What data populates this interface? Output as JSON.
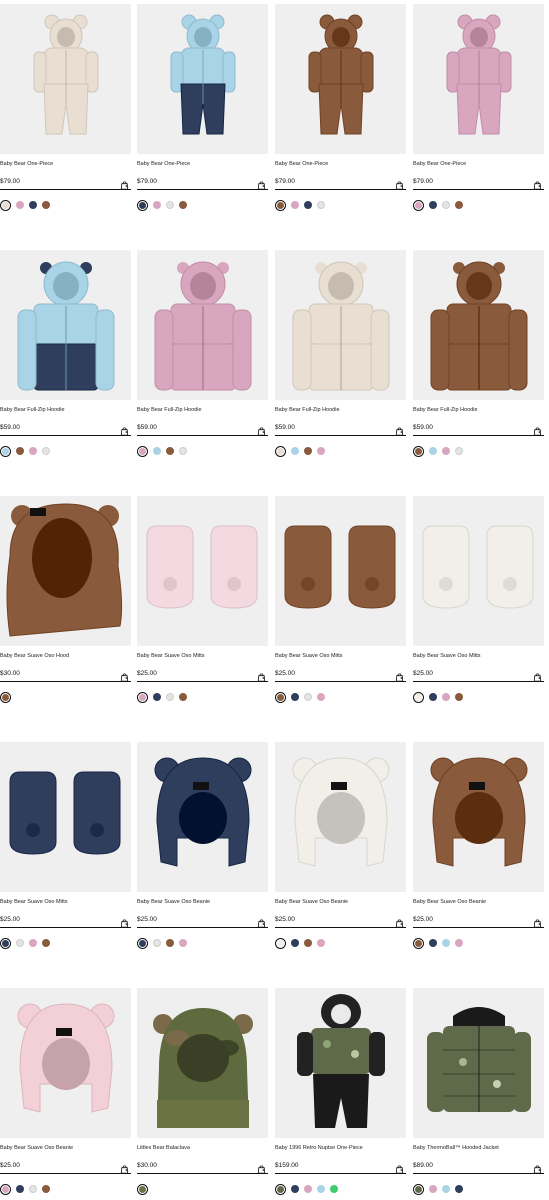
{
  "colors": {
    "cream": "#e8dfd2",
    "pink": "#d9a6bf",
    "navy": "#2e3e5c",
    "brown": "#8a5a3c",
    "lightblue": "#a9d3e6",
    "lightgray": "#e4e4e4",
    "offwhite": "#f2eee8",
    "olive": "#6b7345",
    "green": "#3fcf6f",
    "camo": "#5f6a4a"
  },
  "products": [
    {
      "name": "Baby Bear One-Piece",
      "price": "$79.00",
      "image": "bear-one-piece-cream",
      "swatches": [
        "cream",
        "pink",
        "navy",
        "brown"
      ],
      "selected": 0
    },
    {
      "name": "Baby Bear One-Piece",
      "price": "$79.00",
      "image": "bear-one-piece-blue",
      "swatches": [
        "navy",
        "pink",
        "lightgray",
        "brown"
      ],
      "selected": 0
    },
    {
      "name": "Baby Bear One-Piece",
      "price": "$79.00",
      "image": "bear-one-piece-brown",
      "swatches": [
        "brown",
        "pink",
        "navy",
        "lightgray"
      ],
      "selected": 0
    },
    {
      "name": "Baby Bear One-Piece",
      "price": "$79.00",
      "image": "bear-one-piece-pink",
      "swatches": [
        "pink",
        "navy",
        "lightgray",
        "brown"
      ],
      "selected": 0
    },
    {
      "name": "Baby Bear Full-Zip Hoodie",
      "price": "$59.00",
      "image": "hoodie-blue",
      "swatches": [
        "lightblue",
        "brown",
        "pink",
        "lightgray"
      ],
      "selected": 0
    },
    {
      "name": "Baby Bear Full-Zip Hoodie",
      "price": "$59.00",
      "image": "hoodie-pink",
      "swatches": [
        "pink",
        "lightblue",
        "brown",
        "lightgray"
      ],
      "selected": 0
    },
    {
      "name": "Baby Bear Full-Zip Hoodie",
      "price": "$59.00",
      "image": "hoodie-cream",
      "swatches": [
        "cream",
        "lightblue",
        "brown",
        "pink"
      ],
      "selected": 0
    },
    {
      "name": "Baby Bear Full-Zip Hoodie",
      "price": "$59.00",
      "image": "hoodie-brown",
      "swatches": [
        "brown",
        "lightblue",
        "pink",
        "lightgray"
      ],
      "selected": 0
    },
    {
      "name": "Baby Bear Suave Oso Hood",
      "price": "$30.00",
      "image": "hood-brown",
      "swatches": [
        "brown"
      ],
      "selected": 0
    },
    {
      "name": "Baby Bear Suave Oso Mitts",
      "price": "$25.00",
      "image": "mitts-pink",
      "swatches": [
        "pink",
        "navy",
        "lightgray",
        "brown"
      ],
      "selected": 0
    },
    {
      "name": "Baby Bear Suave Oso Mitts",
      "price": "$25.00",
      "image": "mitts-brown",
      "swatches": [
        "brown",
        "navy",
        "lightgray",
        "pink"
      ],
      "selected": 0
    },
    {
      "name": "Baby Bear Suave Oso Mitts",
      "price": "$25.00",
      "image": "mitts-white",
      "swatches": [
        "offwhite",
        "navy",
        "pink",
        "brown"
      ],
      "selected": 0
    },
    {
      "name": "Baby Bear Suave Oso Mitts",
      "price": "$25.00",
      "image": "mitts-navy",
      "swatches": [
        "navy",
        "lightgray",
        "pink",
        "brown"
      ],
      "selected": 0
    },
    {
      "name": "Baby Bear Suave Oso Beanie",
      "price": "$25.00",
      "image": "beanie-navy",
      "swatches": [
        "navy",
        "lightgray",
        "brown",
        "pink"
      ],
      "selected": 0
    },
    {
      "name": "Baby Bear Suave Oso Beanie",
      "price": "$25.00",
      "image": "beanie-white",
      "swatches": [
        "offwhite",
        "navy",
        "brown",
        "pink"
      ],
      "selected": 0
    },
    {
      "name": "Baby Bear Suave Oso Beanie",
      "price": "$25.00",
      "image": "beanie-brown",
      "swatches": [
        "brown",
        "navy",
        "lightblue",
        "pink"
      ],
      "selected": 0
    },
    {
      "name": "Baby Bear Suave Oso Beanie",
      "price": "$25.00",
      "image": "beanie-pink",
      "swatches": [
        "pink",
        "navy",
        "lightgray",
        "brown"
      ],
      "selected": 0
    },
    {
      "name": "Littles Bear Balaclava",
      "price": "$30.00",
      "image": "balaclava-camo",
      "swatches": [
        "olive"
      ],
      "selected": 0
    },
    {
      "name": "Baby 1996 Retro Nuptse One-Piece",
      "price": "$159.00",
      "image": "nuptse-one-piece",
      "swatches": [
        "camo",
        "navy",
        "pink",
        "lightblue",
        "green"
      ],
      "selected": 0
    },
    {
      "name": "Baby ThermoBall™ Hooded Jacket",
      "price": "$89.00",
      "image": "thermoball-jacket",
      "swatches": [
        "camo",
        "pink",
        "lightblue",
        "navy"
      ],
      "selected": 0
    }
  ]
}
